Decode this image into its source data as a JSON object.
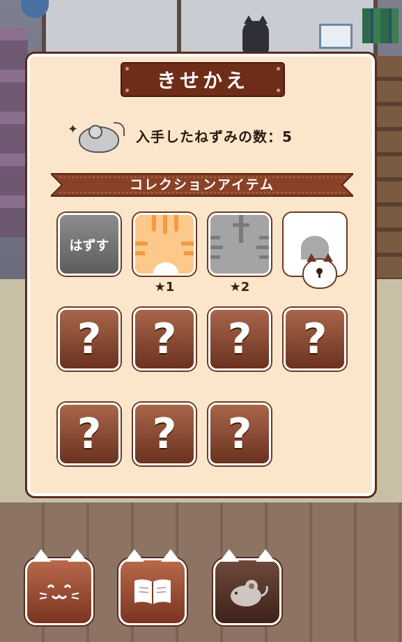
{
  "panel": {
    "title": "きせかえ",
    "mouse_count_label": "入手したねずみの数：5",
    "section_label": "コレクションアイテム"
  },
  "items": {
    "remove_label": "はずす",
    "mystery_mark": "?",
    "orange_cost": "★1",
    "gray_cost": "★2"
  },
  "bottom_nav": [
    {
      "name": "cat-face",
      "glyph": "·ᴥ·"
    },
    {
      "name": "book",
      "glyph": "📖"
    },
    {
      "name": "mouse",
      "glyph": "🐭"
    }
  ],
  "colors": {
    "panel_bg": "#fbe6cc",
    "brown": "#6e2d18",
    "accent_orange": "#fdc98a"
  }
}
